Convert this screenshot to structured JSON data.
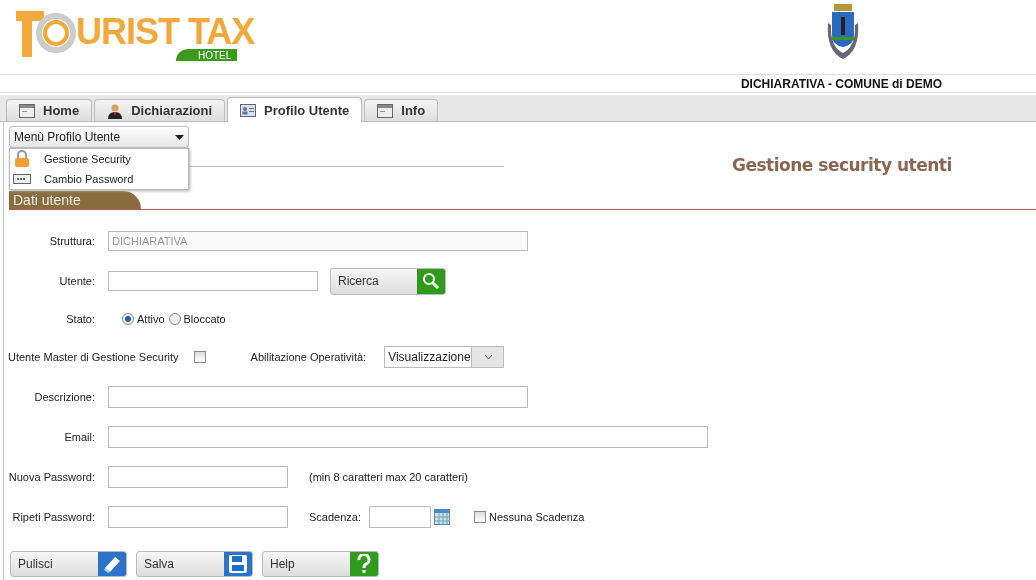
{
  "header": {
    "logo_text": "URIST TAX",
    "logo_badge": "HOTEL",
    "title": "DICHIARATIVA - COMUNE di DEMO"
  },
  "tabs": [
    {
      "label": "Home",
      "selected": false
    },
    {
      "label": "Dichiarazioni",
      "selected": false
    },
    {
      "label": "Profilo Utente",
      "selected": true
    },
    {
      "label": "Info",
      "selected": false
    }
  ],
  "menu": {
    "label": "Menù Profilo Utente",
    "expanded": true,
    "items": [
      {
        "label": "Gestione Security"
      },
      {
        "label": "Cambio Password"
      }
    ]
  },
  "section": {
    "heading": "Dati utente",
    "title": "Gestione security utenti"
  },
  "form": {
    "struttura": {
      "label": "Struttura:",
      "value": "DICHIARATIVA"
    },
    "utente": {
      "label": "Utente:",
      "button": "Ricerca"
    },
    "stato": {
      "label": "Stato:",
      "options": [
        {
          "label": "Attivo",
          "selected": true
        },
        {
          "label": "Bloccato",
          "selected": false
        }
      ]
    },
    "master": {
      "label": "Utente Master di Gestione Security",
      "checked": false
    },
    "abilitazione": {
      "label": "Abilitazione Operatività:",
      "value": "Visualizzazione"
    },
    "descrizione": {
      "label": "Descrizione:"
    },
    "email": {
      "label": "Email:"
    },
    "nuova_password": {
      "label": "Nuova Password:",
      "hint": "(min 8 caratteri max 20 caratteri)"
    },
    "ripeti_password": {
      "label": "Ripeti Password:"
    },
    "scadenza": {
      "label": "Scadenza:"
    },
    "nessuna_scadenza": {
      "label": "Nessuna Scadenza",
      "checked": false
    }
  },
  "buttons": [
    {
      "label": "Pulisci"
    },
    {
      "label": "Salva"
    },
    {
      "label": "Help"
    }
  ]
}
